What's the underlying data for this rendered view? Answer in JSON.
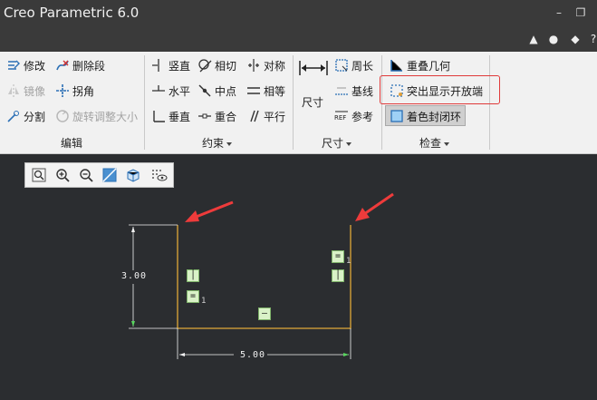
{
  "window": {
    "title": "Creo Parametric 6.0"
  },
  "groups": {
    "edit": {
      "label": "编辑",
      "items": [
        {
          "label": "修改",
          "icon": "modify-icon",
          "enabled": true
        },
        {
          "label": "删除段",
          "icon": "delete-segment-icon",
          "enabled": true
        },
        {
          "label": "镜像",
          "icon": "mirror-icon",
          "enabled": false
        },
        {
          "label": "拐角",
          "icon": "corner-icon",
          "enabled": true
        },
        {
          "label": "分割",
          "icon": "divide-icon",
          "enabled": true
        },
        {
          "label": "旋转调整大小",
          "icon": "rotate-resize-icon",
          "enabled": false
        }
      ]
    },
    "constrain": {
      "label": "约束",
      "items": [
        {
          "label": "竖直",
          "icon": "vertical-icon"
        },
        {
          "label": "相切",
          "icon": "tangent-icon"
        },
        {
          "label": "对称",
          "icon": "symmetric-icon"
        },
        {
          "label": "水平",
          "icon": "horizontal-icon"
        },
        {
          "label": "中点",
          "icon": "midpoint-icon"
        },
        {
          "label": "相等",
          "icon": "equal-icon"
        },
        {
          "label": "垂直",
          "icon": "perpendicular-icon"
        },
        {
          "label": "重合",
          "icon": "coincident-icon"
        },
        {
          "label": "平行",
          "icon": "parallel-icon"
        }
      ]
    },
    "dimension": {
      "label": "尺寸",
      "items": [
        {
          "label": "尺寸",
          "icon": "dimension-icon"
        },
        {
          "label": "周长",
          "icon": "perimeter-icon"
        },
        {
          "label": "基线",
          "icon": "baseline-icon"
        },
        {
          "label": "参考",
          "icon": "reference-icon"
        }
      ]
    },
    "inspect": {
      "label": "检查",
      "items": [
        {
          "label": "重叠几何",
          "icon": "overlap-geometry-icon"
        },
        {
          "label": "突出显示开放端",
          "icon": "highlight-open-ends-icon"
        },
        {
          "label": "着色封闭环",
          "icon": "shade-closed-loops-icon",
          "pressed": true
        }
      ]
    }
  },
  "sketch": {
    "dim_height": "3.00",
    "dim_width": "5.00",
    "constraint_subscript": "1",
    "line_color": "#e0a838",
    "dim_color": "#f2f2f2",
    "arrow_color": "#ee3b3b"
  },
  "colors": {
    "titlebar": "#3a3a3a",
    "ribbon": "#f1f1f1",
    "canvas": "#2b2d30",
    "highlight_box": "#e03a3a"
  }
}
